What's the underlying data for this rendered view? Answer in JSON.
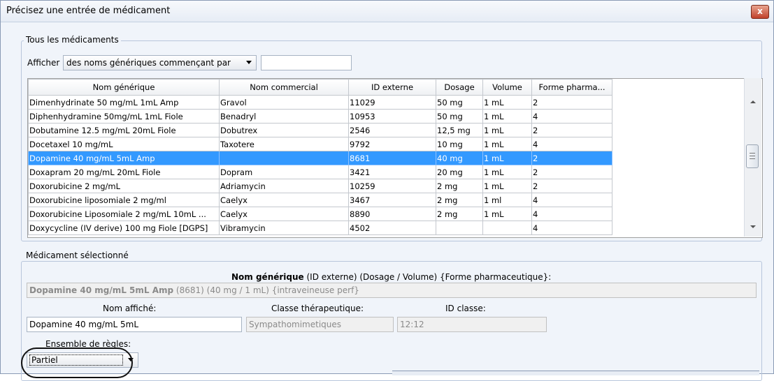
{
  "window": {
    "title": "Précisez une entrée de médicament",
    "close_glyph": "x"
  },
  "all_drugs": {
    "legend": "Tous les médicaments",
    "show_label": "Afficher",
    "filter_value": "des noms génériques commençant par",
    "search_value": "",
    "columns": [
      "Nom générique",
      "Nom commercial",
      "ID externe",
      "Dosage",
      "Volume",
      "Forme pharma..."
    ],
    "rows": [
      [
        "Dimenhydrinate  50 mg/mL  1mL Amp",
        "Gravol",
        "11029",
        "50 mg",
        "1 mL",
        "2"
      ],
      [
        "Diphenhydramine 50mg/mL 1mL Fiole",
        "Benadryl",
        "10953",
        "50 mg",
        "1 mL",
        "4"
      ],
      [
        "Dobutamine 12.5 mg/mL  20mL Fiole",
        "Dobutrex",
        "2546",
        "12,5 mg",
        "1 mL",
        "2"
      ],
      [
        "Docetaxel 10 mg/mL",
        "Taxotere",
        "9792",
        "10 mg",
        "1 mL",
        "4"
      ],
      [
        "Dopamine 40 mg/mL  5mL Amp",
        "",
        "8681",
        "40 mg",
        "1 mL",
        "2"
      ],
      [
        "Doxapram 20 mg/mL  20mL Fiole",
        "Dopram",
        "3421",
        "20 mg",
        "1 mL",
        "2"
      ],
      [
        "Doxorubicine 2 mg/mL",
        "Adriamycin",
        "10259",
        "2 mg",
        "1 mL",
        "2"
      ],
      [
        "Doxorubicine liposomiale 2 mg/ml",
        "Caelyx",
        "3467",
        "2 mg",
        "1 ml",
        "4"
      ],
      [
        "Doxorubicine Liposomiale 2 mg/mL  10mL ...",
        "Caelyx",
        "8890",
        "2 mg",
        "1 mL",
        "4"
      ],
      [
        "Doxycycline (IV derive) 100 mg Fiole [DGPS]",
        "Vibramycin",
        "4502",
        "",
        "",
        "4"
      ]
    ],
    "selected_row_index": 4
  },
  "selected": {
    "legend": "Médicament sélectionné",
    "header_bold": "Nom générique",
    "header_rest": " (ID externe) (Dosage / Volume) {Forme pharmaceutique}:",
    "summary_bold": "Dopamine 40 mg/mL 5mL Amp",
    "summary_rest": " (8681) (40 mg / 1 mL) {intraveineuse perf}",
    "display_name_label": "Nom affiché:",
    "display_name_value": "Dopamine 40 mg/mL  5mL",
    "therapeutic_class_label": "Classe thérapeutique:",
    "therapeutic_class_value": "Sympathomimetiques",
    "class_id_label": "ID classe:",
    "class_id_value": "12:12",
    "rules_label": "Ensemble de règles:",
    "rules_value": "Partiel"
  },
  "icons": {
    "close": "close-icon",
    "dropdown": "chevron-down-icon",
    "scroll_up": "arrow-up-icon",
    "scroll_down": "arrow-down-icon"
  },
  "colors": {
    "selection": "#3399ff",
    "close_button": "#c0412b",
    "group_border": "#b8c6dc"
  }
}
